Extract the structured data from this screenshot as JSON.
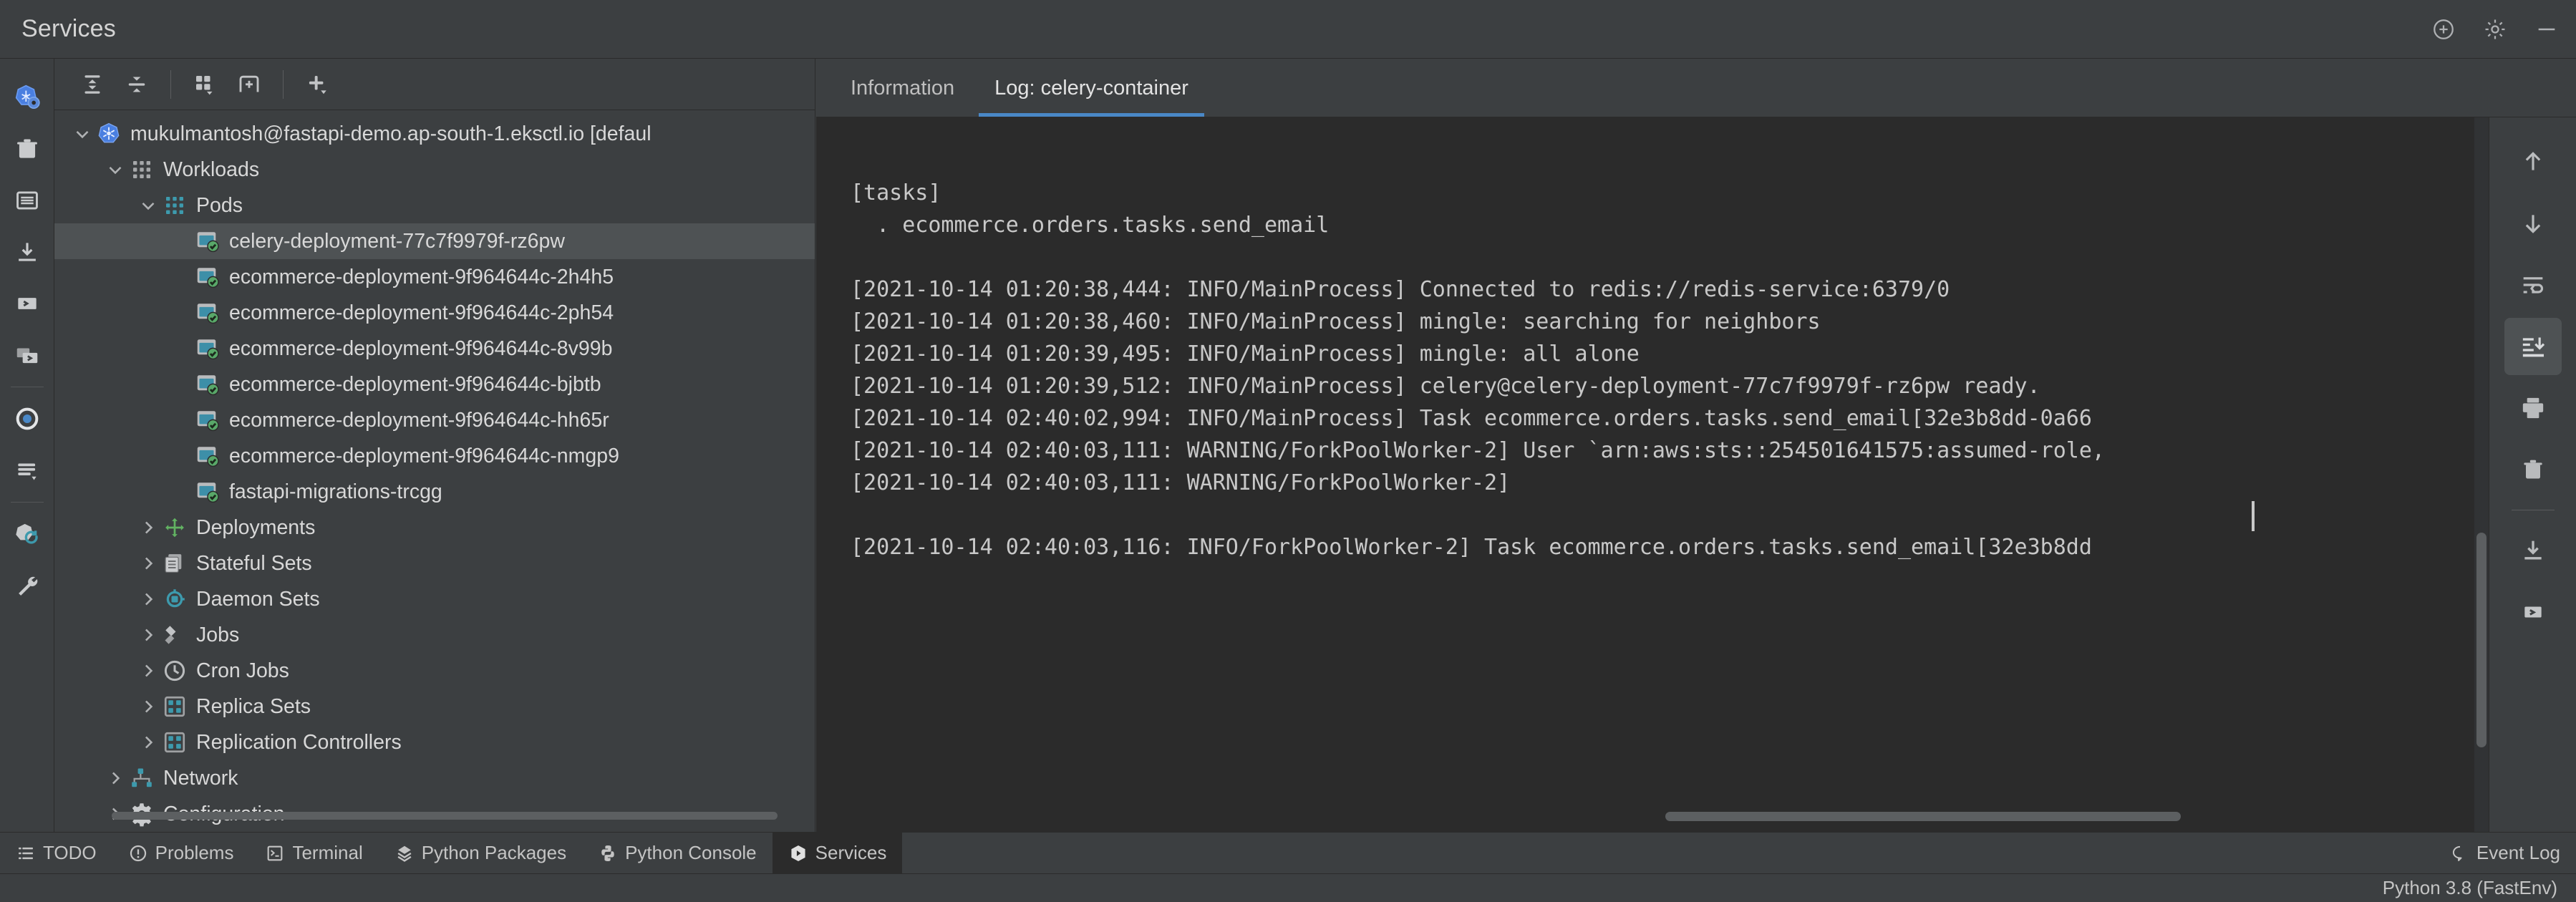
{
  "window": {
    "title": "Services",
    "titlebar_icons": [
      "inspection-widget-icon",
      "settings-gear-icon",
      "minimize-icon"
    ]
  },
  "left_strip": {
    "items": [
      {
        "name": "kubernetes-settings-icon",
        "label": "Kubernetes Settings"
      },
      {
        "name": "delete-icon",
        "label": "Delete"
      },
      {
        "name": "describe-resource-icon",
        "label": "Describe Resource"
      },
      {
        "name": "download-logs-icon",
        "label": "Download Logs"
      },
      {
        "name": "open-console-icon",
        "label": "Open Console"
      },
      {
        "name": "open-shell-icon",
        "label": "Open Shell"
      },
      {
        "name": "follow-logs-icon",
        "label": "Follow Logs"
      },
      {
        "name": "show-logs-icon",
        "label": "Show Logs"
      },
      {
        "name": "refresh-icon",
        "label": "Refresh"
      },
      {
        "name": "settings-wrench-icon",
        "label": "Settings"
      }
    ]
  },
  "tree_toolbar": {
    "buttons": [
      {
        "name": "expand-all-button",
        "label": "Expand All"
      },
      {
        "name": "collapse-all-button",
        "label": "Collapse All"
      },
      {
        "name": "group-by-button",
        "label": "Group By"
      },
      {
        "name": "add-tab-button",
        "label": "Add Tab"
      },
      {
        "name": "add-service-button",
        "label": "Add Service"
      }
    ]
  },
  "tree": {
    "items": [
      {
        "label": "mukulmantosh@fastapi-demo.ap-south-1.eksctl.io [defaul",
        "icon": "kubernetes-cluster-icon",
        "indent": 0,
        "arrow": "down",
        "selected": false
      },
      {
        "label": "Workloads",
        "icon": "workloads-icon",
        "indent": 1,
        "arrow": "down",
        "selected": false
      },
      {
        "label": "Pods",
        "icon": "pods-icon",
        "indent": 2,
        "arrow": "down",
        "selected": false
      },
      {
        "label": "celery-deployment-77c7f9979f-rz6pw",
        "icon": "pod-running-icon",
        "indent": 3,
        "arrow": "none",
        "selected": true
      },
      {
        "label": "ecommerce-deployment-9f964644c-2h4h5",
        "icon": "pod-running-icon",
        "indent": 3,
        "arrow": "none",
        "selected": false
      },
      {
        "label": "ecommerce-deployment-9f964644c-2ph54",
        "icon": "pod-running-icon",
        "indent": 3,
        "arrow": "none",
        "selected": false
      },
      {
        "label": "ecommerce-deployment-9f964644c-8v99b",
        "icon": "pod-running-icon",
        "indent": 3,
        "arrow": "none",
        "selected": false
      },
      {
        "label": "ecommerce-deployment-9f964644c-bjbtb",
        "icon": "pod-running-icon",
        "indent": 3,
        "arrow": "none",
        "selected": false
      },
      {
        "label": "ecommerce-deployment-9f964644c-hh65r",
        "icon": "pod-running-icon",
        "indent": 3,
        "arrow": "none",
        "selected": false
      },
      {
        "label": "ecommerce-deployment-9f964644c-nmgp9",
        "icon": "pod-running-icon",
        "indent": 3,
        "arrow": "none",
        "selected": false
      },
      {
        "label": "fastapi-migrations-trcgg",
        "icon": "pod-running-icon",
        "indent": 3,
        "arrow": "none",
        "selected": false
      },
      {
        "label": "Deployments",
        "icon": "deployments-icon",
        "indent": 2,
        "arrow": "right",
        "selected": false
      },
      {
        "label": "Stateful Sets",
        "icon": "stateful-sets-icon",
        "indent": 2,
        "arrow": "right",
        "selected": false
      },
      {
        "label": "Daemon Sets",
        "icon": "daemon-sets-icon",
        "indent": 2,
        "arrow": "right",
        "selected": false
      },
      {
        "label": "Jobs",
        "icon": "jobs-icon",
        "indent": 2,
        "arrow": "right",
        "selected": false
      },
      {
        "label": "Cron Jobs",
        "icon": "cron-jobs-icon",
        "indent": 2,
        "arrow": "right",
        "selected": false
      },
      {
        "label": "Replica Sets",
        "icon": "replica-sets-icon",
        "indent": 2,
        "arrow": "right",
        "selected": false
      },
      {
        "label": "Replication Controllers",
        "icon": "replication-controllers-icon",
        "indent": 2,
        "arrow": "right",
        "selected": false
      },
      {
        "label": "Network",
        "icon": "network-icon",
        "indent": 1,
        "arrow": "right",
        "selected": false
      },
      {
        "label": "Configuration",
        "icon": "configuration-icon",
        "indent": 1,
        "arrow": "right",
        "selected": false
      }
    ]
  },
  "log_panel": {
    "tabs": [
      {
        "label": "Information",
        "active": false
      },
      {
        "label": "Log: celery-container",
        "active": true
      }
    ],
    "lines": [
      "",
      "[tasks]",
      "  . ecommerce.orders.tasks.send_email",
      "",
      "[2021-10-14 01:20:38,444: INFO/MainProcess] Connected to redis://redis-service:6379/0",
      "[2021-10-14 01:20:38,460: INFO/MainProcess] mingle: searching for neighbors",
      "[2021-10-14 01:20:39,495: INFO/MainProcess] mingle: all alone",
      "[2021-10-14 01:20:39,512: INFO/MainProcess] celery@celery-deployment-77c7f9979f-rz6pw ready.",
      "[2021-10-14 02:40:02,994: INFO/MainProcess] Task ecommerce.orders.tasks.send_email[32e3b8dd-0a66",
      "[2021-10-14 02:40:03,111: WARNING/ForkPoolWorker-2] User `arn:aws:sts::254501641575:assumed-role,",
      "[2021-10-14 02:40:03,111: WARNING/ForkPoolWorker-2]",
      "",
      "[2021-10-14 02:40:03,116: INFO/ForkPoolWorker-2] Task ecommerce.orders.tasks.send_email[32e3b8dd"
    ],
    "tools": [
      {
        "name": "scroll-up-icon",
        "label": "Previous Occurrence",
        "active": false
      },
      {
        "name": "scroll-down-icon",
        "label": "Next Occurrence",
        "active": false
      },
      {
        "name": "soft-wrap-icon",
        "label": "Soft-Wrap",
        "active": false
      },
      {
        "name": "scroll-to-end-icon",
        "label": "Scroll to the End",
        "active": true
      },
      {
        "name": "print-icon",
        "label": "Print",
        "active": false
      },
      {
        "name": "clear-all-icon",
        "label": "Clear All",
        "active": false
      },
      {
        "name": "download-icon",
        "label": "Download Log",
        "active": false
      },
      {
        "name": "open-console-icon",
        "label": "Open Console",
        "active": false
      }
    ]
  },
  "bottom_bar": {
    "items": [
      {
        "label": "TODO",
        "icon": "todo-icon",
        "active": false
      },
      {
        "label": "Problems",
        "icon": "problems-icon",
        "active": false
      },
      {
        "label": "Terminal",
        "icon": "terminal-icon",
        "active": false
      },
      {
        "label": "Python Packages",
        "icon": "python-packages-icon",
        "active": false
      },
      {
        "label": "Python Console",
        "icon": "python-console-icon",
        "active": false
      },
      {
        "label": "Services",
        "icon": "services-icon",
        "active": true
      }
    ],
    "event_log": {
      "label": "Event Log",
      "icon": "event-log-icon"
    }
  },
  "status_bar": {
    "interpreter": "Python 3.8 (FastEnv)"
  },
  "colors": {
    "accent": "#4a88c7",
    "panel_bg": "#3c3f41",
    "editor_bg": "#2b2b2b",
    "selection": "#4e5254",
    "text": "#d8d8d8",
    "kube_blue": "#3a6fd8",
    "status_green": "#59a869",
    "teal": "#3d9aad"
  }
}
